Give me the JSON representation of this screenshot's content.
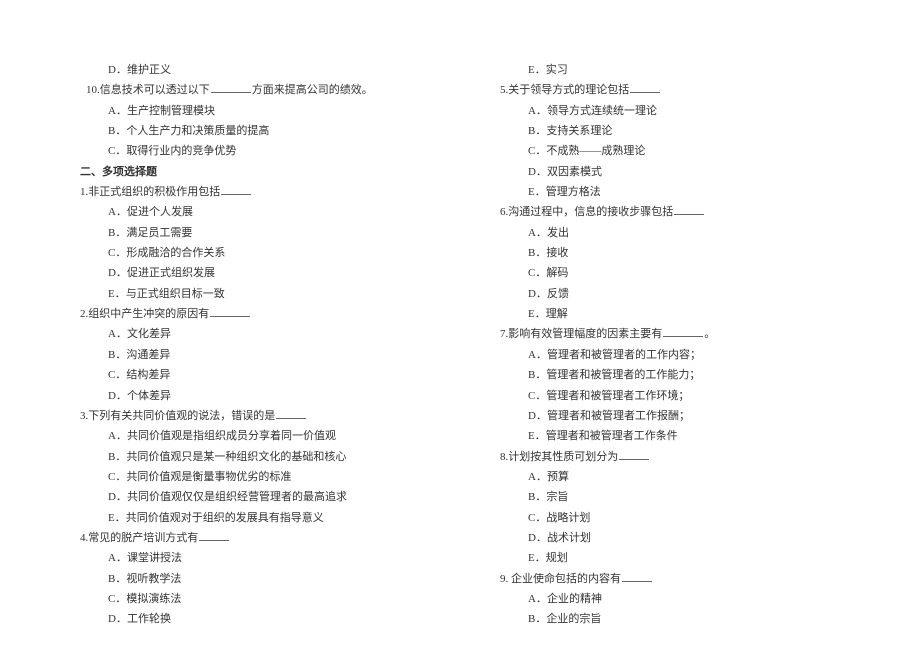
{
  "left": {
    "opt_prev_d": "D．维护正义",
    "q10_text_a": "10.信息技术可以透过以下",
    "q10_text_b": "方面来提高公司的绩效。",
    "q10_a": "A．生产控制管理模块",
    "q10_b": "B．个人生产力和决策质量的提高",
    "q10_c": "C．取得行业内的竞争优势",
    "section2": "二、多项选择题",
    "q1_text": "1.非正式组织的积极作用包括",
    "q1_a": "A．促进个人发展",
    "q1_b": "B．满足员工需要",
    "q1_c": "C．形成融洽的合作关系",
    "q1_d": "D．促进正式组织发展",
    "q1_e": "E．与正式组织目标一致",
    "q2_text": "2.组织中产生冲突的原因有",
    "q2_a": "A．文化差异",
    "q2_b": "B．沟通差异",
    "q2_c": "C．结构差异",
    "q2_d": "D．个体差异",
    "q3_text": "3.下列有关共同价值观的说法，错误的是",
    "q3_a": "A．共同价值观是指组织成员分享着同一价值观",
    "q3_b": "B．共同价值观只是某一种组织文化的基础和核心",
    "q3_c": "C．共同价值观是衡量事物优劣的标准",
    "q3_d": "D．共同价值观仅仅是组织经营管理者的最高追求",
    "q3_e": "E．共同价值观对于组织的发展具有指导意义",
    "q4_text": "4.常见的脱产培训方式有",
    "q4_a": "A．课堂讲授法",
    "q4_b": "B．视听教学法",
    "q4_c": "C．模拟演练法",
    "q4_d": "D．工作轮换"
  },
  "right": {
    "opt_prev_e": "E．实习",
    "q5_text": "5.关于领导方式的理论包括",
    "q5_a": "A．领导方式连续统一理论",
    "q5_b": "B．支持关系理论",
    "q5_c": "C．不成熟——成熟理论",
    "q5_d": "D．双因素模式",
    "q5_e": "E．管理方格法",
    "q6_text": "6.沟通过程中，信息的接收步骤包括",
    "q6_a": "A．发出",
    "q6_b": "B．接收",
    "q6_c": "C．解码",
    "q6_d": "D．反馈",
    "q6_e": "E．理解",
    "q7_text_a": "7.影响有效管理幅度的因素主要有",
    "q7_text_b": "。",
    "q7_a": "A．管理者和被管理者的工作内容；",
    "q7_b": "B．管理者和被管理者的工作能力；",
    "q7_c": "C．管理者和被管理者工作环境；",
    "q7_d": "D．管理者和被管理者工作报酬；",
    "q7_e": "E．管理者和被管理者工作条件",
    "q8_text": "8.计划按其性质可划分为",
    "q8_a": "A．预算",
    "q8_b": "B．宗旨",
    "q8_c": "C．战略计划",
    "q8_d": "D．战术计划",
    "q8_e": "E．规划",
    "q9_text": "9. 企业使命包括的内容有",
    "q9_a": "A．企业的精神",
    "q9_b": "B．企业的宗旨"
  }
}
